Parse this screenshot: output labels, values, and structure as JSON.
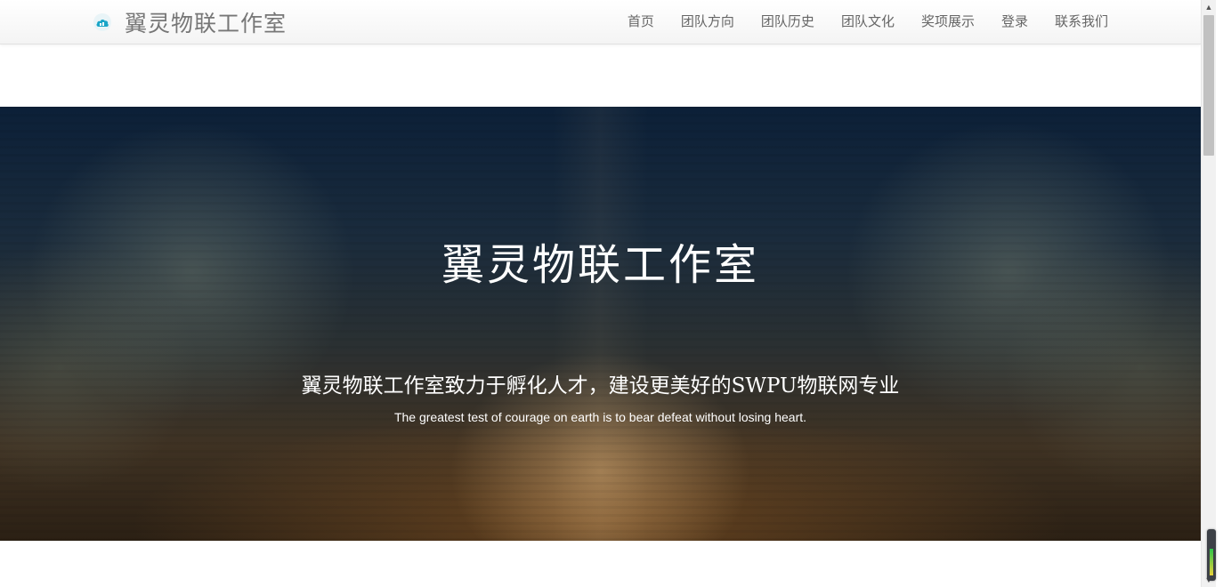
{
  "navbar": {
    "brand_name": "翼灵物联工作室",
    "logo_icon": "cloud-icon",
    "menu": [
      {
        "label": "首页"
      },
      {
        "label": "团队方向"
      },
      {
        "label": "团队历史"
      },
      {
        "label": "团队文化"
      },
      {
        "label": "奖项展示"
      },
      {
        "label": "登录"
      },
      {
        "label": "联系我们"
      }
    ]
  },
  "hero": {
    "title": "翼灵物联工作室",
    "subtitle": "翼灵物联工作室致力于孵化人才，建设更美好的SWPU物联网专业",
    "quote": "The greatest test of courage on earth is to bear defeat without losing heart."
  },
  "colors": {
    "navbar_bg": "#f7f7f7",
    "nav_text": "#666666",
    "brand_text": "#777777",
    "logo_accent": "#1aa5c7",
    "hero_text": "#ffffff"
  }
}
